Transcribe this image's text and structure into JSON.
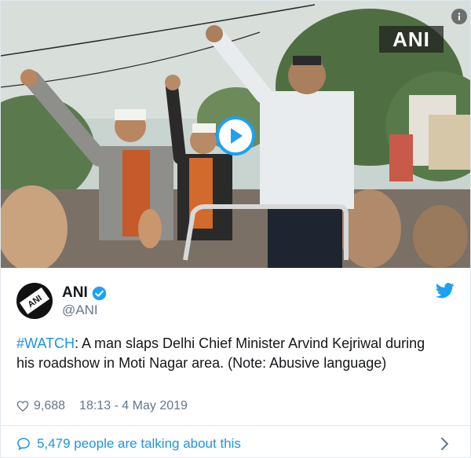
{
  "media": {
    "watermark": "ANI",
    "info_icon": "info-icon",
    "play_icon": "play-icon"
  },
  "author": {
    "name": "ANI",
    "handle": "@ANI",
    "avatar_text": "ANI",
    "verified_icon": "verified-badge-icon"
  },
  "tweet": {
    "hashtag": "#WATCH",
    "body": ": A man slaps Delhi Chief Minister Arvind Kejriwal during his roadshow in Moti Nagar area. (Note: Abusive language)"
  },
  "meta": {
    "likes": "9,688",
    "timestamp": "18:13 - 4 May 2019"
  },
  "footer": {
    "talking": "5,479 people are talking about this"
  },
  "colors": {
    "brand_blue": "#1da1f2",
    "link_blue": "#1b95e0",
    "muted_gray": "#657786",
    "border": "#e1e8ed"
  }
}
